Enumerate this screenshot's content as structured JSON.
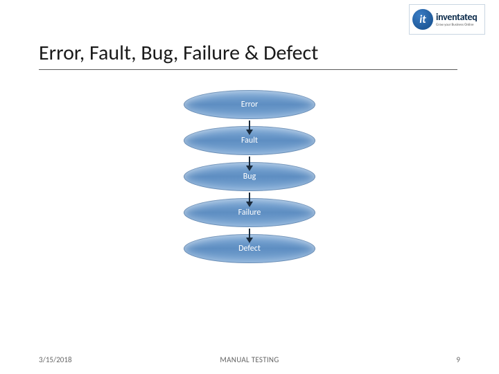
{
  "logo": {
    "mark_letter": "it",
    "word": "inventateq",
    "tagline": "Grow your Business Online"
  },
  "title": "Error, Fault, Bug, Failure & Defect",
  "diagram": {
    "nodes": [
      "Error",
      "Fault",
      "Bug",
      "Failure",
      "Defect"
    ]
  },
  "footer": {
    "date": "3/15/2018",
    "center": "MANUAL TESTING",
    "page": "9"
  }
}
